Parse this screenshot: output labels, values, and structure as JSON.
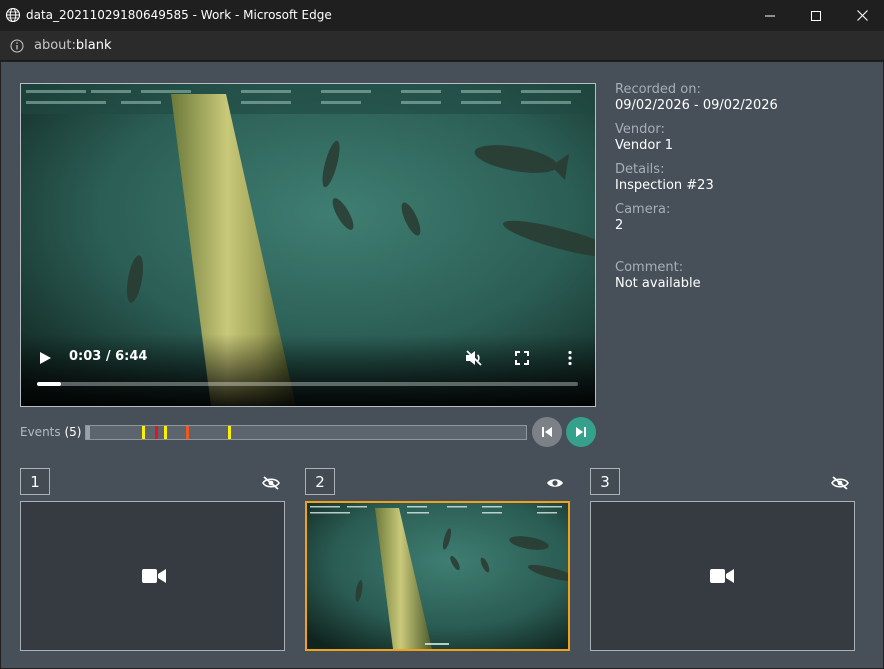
{
  "window": {
    "title": "data_20211029180649585 - Work - Microsoft Edge",
    "url_prefix": "about:",
    "url_rest": "blank"
  },
  "video": {
    "time": "0:03 / 6:44",
    "progress_fraction": 0.045
  },
  "metadata": {
    "recorded_label": "Recorded on:",
    "recorded_value": "09/02/2026 - 09/02/2026",
    "vendor_label": "Vendor:",
    "vendor_value": "Vendor 1",
    "details_label": "Details:",
    "details_value": "Inspection #23",
    "camera_label": "Camera:",
    "camera_value": "2",
    "comment_label": "Comment:",
    "comment_value": "Not available"
  },
  "events": {
    "label": "Events",
    "count": "(5)",
    "played_fraction": 0.01,
    "markers": [
      {
        "position": 0.127,
        "color": "#ffef00"
      },
      {
        "position": 0.157,
        "color": "#e8141b"
      },
      {
        "position": 0.177,
        "color": "#ffef00"
      },
      {
        "position": 0.227,
        "color": "#f0581e"
      },
      {
        "position": 0.322,
        "color": "#ffef00"
      }
    ]
  },
  "cameras": [
    {
      "number": "1",
      "visible": false,
      "active": false
    },
    {
      "number": "2",
      "visible": true,
      "active": true
    },
    {
      "number": "3",
      "visible": false,
      "active": false
    }
  ],
  "colors": {
    "accent": "#f0a21b",
    "next_button": "#35a08c",
    "panel": "#475059"
  }
}
